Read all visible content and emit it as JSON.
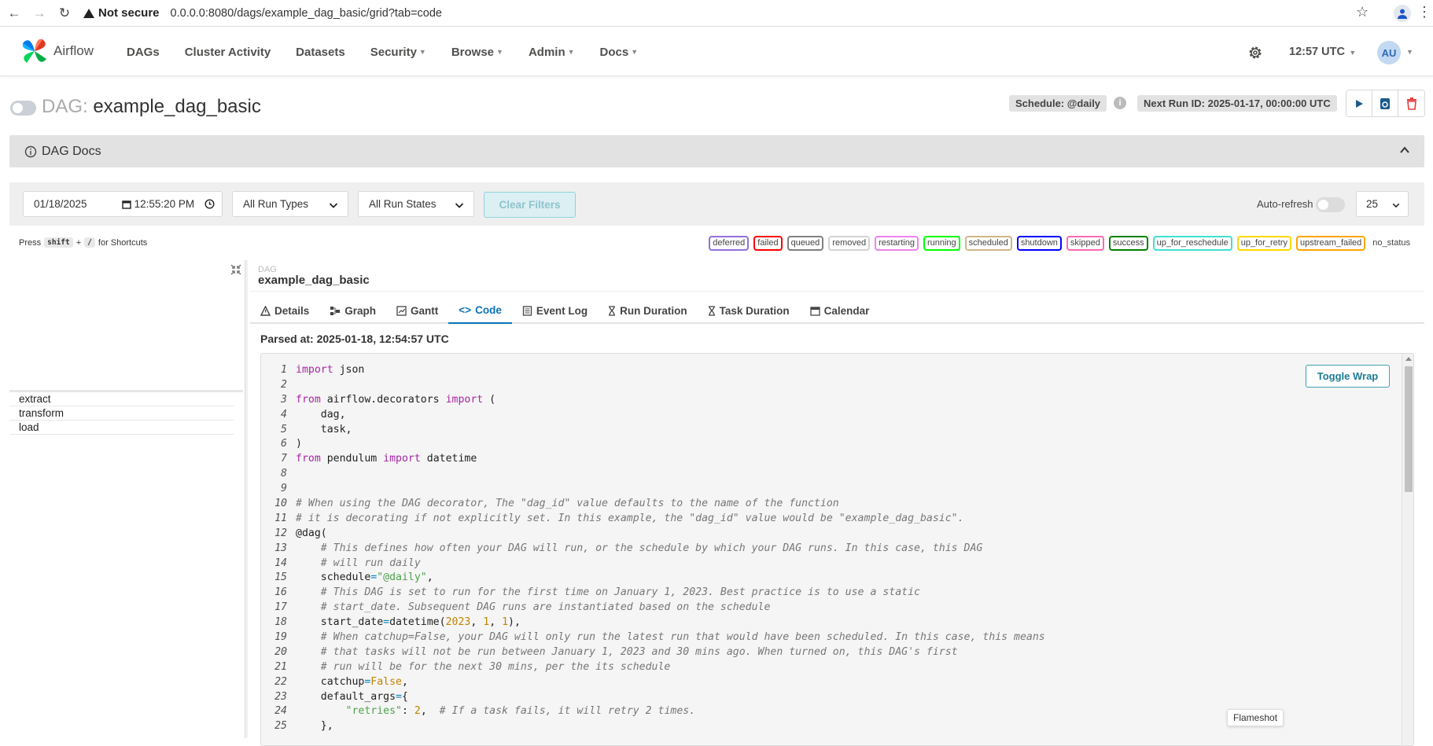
{
  "browser": {
    "security_label": "Not secure",
    "url": "0.0.0.0:8080/dags/example_dag_basic/grid?tab=code"
  },
  "navbar": {
    "logo_text": "Airflow",
    "menu": [
      {
        "label": "DAGs",
        "dropdown": false
      },
      {
        "label": "Cluster Activity",
        "dropdown": false
      },
      {
        "label": "Datasets",
        "dropdown": false
      },
      {
        "label": "Security",
        "dropdown": true
      },
      {
        "label": "Browse",
        "dropdown": true
      },
      {
        "label": "Admin",
        "dropdown": true
      },
      {
        "label": "Docs",
        "dropdown": true
      }
    ],
    "time": "12:57 UTC",
    "avatar": "AU"
  },
  "dag_header": {
    "label": "DAG:",
    "dag_id": "example_dag_basic",
    "schedule": "Schedule: @daily",
    "next_run": "Next Run ID: 2025-01-17, 00:00:00 UTC"
  },
  "docs": {
    "title": "DAG Docs"
  },
  "filters": {
    "date": "01/18/2025",
    "time": "12:55:20 PM",
    "run_types": "All Run Types",
    "run_states": "All Run States",
    "clear_label": "Clear Filters",
    "autorefresh_label": "Auto-refresh",
    "page_size": "25"
  },
  "shortcuts": {
    "press": "Press",
    "key1": "shift",
    "plus": "+",
    "key2": "/",
    "suffix": "for Shortcuts"
  },
  "legend": [
    {
      "label": "deferred",
      "color": "#9370db"
    },
    {
      "label": "failed",
      "color": "#ff0000"
    },
    {
      "label": "queued",
      "color": "#808080"
    },
    {
      "label": "removed",
      "color": "#d3d3d3"
    },
    {
      "label": "restarting",
      "color": "#ee82ee"
    },
    {
      "label": "running",
      "color": "#00ff00"
    },
    {
      "label": "scheduled",
      "color": "#d2b48c"
    },
    {
      "label": "shutdown",
      "color": "#0000ff"
    },
    {
      "label": "skipped",
      "color": "#ff69b4"
    },
    {
      "label": "success",
      "color": "#008000"
    },
    {
      "label": "up_for_reschedule",
      "color": "#40e0d0"
    },
    {
      "label": "up_for_retry",
      "color": "#ffd700"
    },
    {
      "label": "upstream_failed",
      "color": "#ffa500"
    },
    {
      "label": "no_status",
      "color": null
    }
  ],
  "tasks": [
    "extract",
    "transform",
    "load"
  ],
  "details": {
    "small_label": "DAG",
    "dag_name": "example_dag_basic",
    "tabs": [
      "Details",
      "Graph",
      "Gantt",
      "Code",
      "Event Log",
      "Run Duration",
      "Task Duration",
      "Calendar"
    ],
    "active_tab": "Code",
    "parsed_at": "Parsed at: 2025-01-18, 12:54:57 UTC",
    "toggle_wrap": "Toggle Wrap"
  },
  "flameshot": "Flameshot",
  "code_lines": [
    [
      [
        "kw",
        "import"
      ],
      [
        "src",
        " json"
      ]
    ],
    [],
    [
      [
        "kw",
        "from"
      ],
      [
        "src",
        " airflow.decorators "
      ],
      [
        "kw",
        "import"
      ],
      [
        "src",
        " ("
      ]
    ],
    [
      [
        "src",
        "    dag,"
      ]
    ],
    [
      [
        "src",
        "    task,"
      ]
    ],
    [
      [
        "src",
        ")"
      ]
    ],
    [
      [
        "kw",
        "from"
      ],
      [
        "src",
        " pendulum "
      ],
      [
        "kw",
        "import"
      ],
      [
        "src",
        " datetime"
      ]
    ],
    [],
    [],
    [
      [
        "cm",
        "# When using the DAG decorator, The \"dag_id\" value defaults to the name of the function"
      ]
    ],
    [
      [
        "cm",
        "# it is decorating if not explicitly set. In this example, the \"dag_id\" value would be \"example_dag_basic\"."
      ]
    ],
    [
      [
        "src",
        "@dag("
      ]
    ],
    [
      [
        "cm",
        "    # This defines how often your DAG will run, or the schedule by which your DAG runs. In this case, this DAG"
      ]
    ],
    [
      [
        "cm",
        "    # will run daily"
      ]
    ],
    [
      [
        "src",
        "    schedule"
      ],
      [
        "op",
        "="
      ],
      [
        "st",
        "\"@daily\""
      ],
      [
        "src",
        ","
      ]
    ],
    [
      [
        "cm",
        "    # This DAG is set to run for the first time on January 1, 2023. Best practice is to use a static"
      ]
    ],
    [
      [
        "cm",
        "    # start_date. Subsequent DAG runs are instantiated based on the schedule"
      ]
    ],
    [
      [
        "src",
        "    start_date"
      ],
      [
        "op",
        "="
      ],
      [
        "src",
        "datetime("
      ],
      [
        "nm",
        "2023"
      ],
      [
        "src",
        ", "
      ],
      [
        "nm",
        "1"
      ],
      [
        "src",
        ", "
      ],
      [
        "nm",
        "1"
      ],
      [
        "src",
        "),"
      ]
    ],
    [
      [
        "cm",
        "    # When catchup=False, your DAG will only run the latest run that would have been scheduled. In this case, this means"
      ]
    ],
    [
      [
        "cm",
        "    # that tasks will not be run between January 1, 2023 and 30 mins ago. When turned on, this DAG's first"
      ]
    ],
    [
      [
        "cm",
        "    # run will be for the next 30 mins, per the its schedule"
      ]
    ],
    [
      [
        "src",
        "    catchup"
      ],
      [
        "op",
        "="
      ],
      [
        "nm",
        "False"
      ],
      [
        "src",
        ","
      ]
    ],
    [
      [
        "src",
        "    default_args"
      ],
      [
        "op",
        "="
      ],
      [
        "src",
        "{"
      ]
    ],
    [
      [
        "st",
        "        \"retries\""
      ],
      [
        "src",
        ": "
      ],
      [
        "nm",
        "2"
      ],
      [
        "src",
        ",  "
      ],
      [
        "cm",
        "# If a task fails, it will retry 2 times."
      ]
    ],
    [
      [
        "src",
        "    },"
      ]
    ]
  ]
}
